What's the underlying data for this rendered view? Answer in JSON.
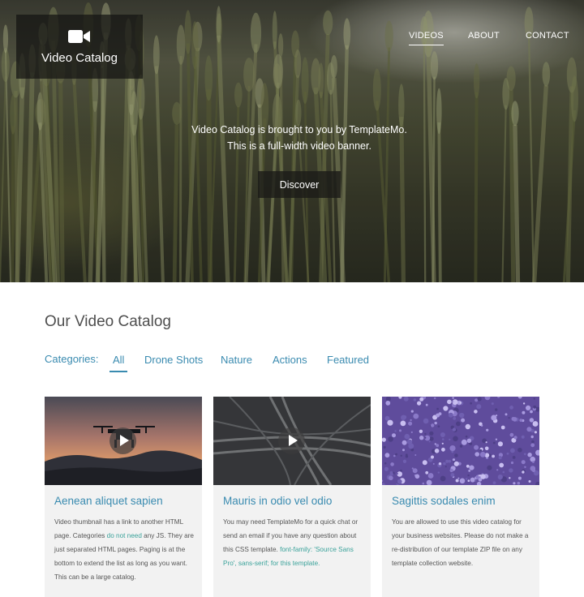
{
  "brand": {
    "icon": "video-camera-icon",
    "name": "Video Catalog"
  },
  "nav": {
    "items": [
      {
        "label": "VIDEOS",
        "active": true
      },
      {
        "label": "ABOUT",
        "active": false
      },
      {
        "label": "CONTACT",
        "active": false
      }
    ]
  },
  "hero": {
    "line1": "Video Catalog is brought to you by TemplateMo.",
    "line2": "This is a full-width video banner.",
    "button": "Discover"
  },
  "catalog": {
    "title": "Our Video Catalog",
    "categories_label": "Categories:",
    "categories": [
      "All",
      "Drone Shots",
      "Nature",
      "Actions",
      "Featured"
    ],
    "active_category": "All"
  },
  "cards": [
    {
      "title": "Aenean aliquet sapien",
      "thumbnail": "drone-sunset",
      "has_play": true,
      "body_parts": [
        {
          "text": "Video thumbnail has a link to another HTML page. Categories "
        },
        {
          "text": "do not need",
          "link": true
        },
        {
          "text": " any JS. They are just separated HTML pages. Paging is at the bottom to extend the list as long as you want. This can be a large catalog."
        }
      ]
    },
    {
      "title": "Mauris in odio vel odio",
      "thumbnail": "aerial-highway",
      "has_play": true,
      "body_parts": [
        {
          "text": "You may need TemplateMo for a quick chat or send an email if you have any question about this CSS template. "
        },
        {
          "text": "font-family: 'Source Sans Pro', sans-serif; for this template.",
          "link": true
        }
      ]
    },
    {
      "title": "Sagittis sodales enim",
      "thumbnail": "lavender-closeup",
      "has_play": false,
      "body_parts": [
        {
          "text": "You are allowed to use this video catalog for your business websites. Please do not make a re-distribution of our template ZIP file on any template collection website."
        }
      ]
    }
  ],
  "colors": {
    "accent": "#3a8bb0",
    "link_green": "#3aa29a",
    "card_bg": "#f2f2f2",
    "title_gray": "#4f4f4f"
  }
}
